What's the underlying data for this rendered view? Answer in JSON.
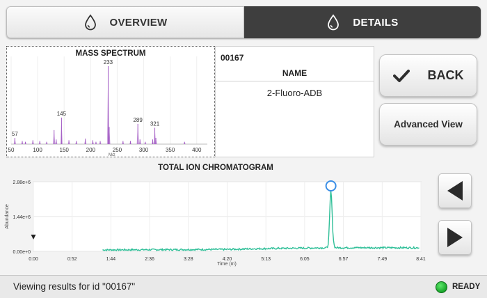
{
  "tabs": [
    {
      "label": "OVERVIEW",
      "icon": "droplet-icon",
      "active": false
    },
    {
      "label": "DETAILS",
      "icon": "droplet-icon",
      "active": true
    }
  ],
  "spectrum": {
    "title": "MASS SPECTRUM",
    "xlabel": "M/z",
    "x_ticks": [
      "50",
      "100",
      "150",
      "200",
      "250",
      "300",
      "350",
      "400"
    ]
  },
  "info": {
    "id": "00167",
    "name_label": "NAME",
    "name_value": "2-Fluoro-ADB"
  },
  "buttons": {
    "back": "BACK",
    "advanced": "Advanced View"
  },
  "tic": {
    "title": "TOTAL ION CHROMATOGRAM",
    "ylabel": "Abundance",
    "xlabel": "Time (m)",
    "y_ticks": [
      "2.88e+6",
      "1.44e+6",
      "0.00e+0"
    ],
    "x_ticks": [
      "0:00",
      "0:52",
      "1:44",
      "2:36",
      "3:28",
      "4:20",
      "5:13",
      "6:05",
      "6:57",
      "7:49",
      "8:41"
    ]
  },
  "status": {
    "text": "Viewing results for id \"00167\"",
    "ready": "READY",
    "ready_color": "#22b43a"
  },
  "colors": {
    "spectrum_peaks": "#a35bc4",
    "tic_line": "#2fbf98",
    "marker": "#3a8ee6",
    "tab_active_bg": "#3e3e3e"
  },
  "chart_data": [
    {
      "type": "bar",
      "title": "MASS SPECTRUM",
      "xlabel": "M/z",
      "ylabel": "",
      "xlim": [
        50,
        420
      ],
      "ylim": [
        0,
        100
      ],
      "peaks": [
        {
          "mz": 57,
          "intensity": 8,
          "label": "57"
        },
        {
          "mz": 71,
          "intensity": 4
        },
        {
          "mz": 77,
          "intensity": 3
        },
        {
          "mz": 91,
          "intensity": 5
        },
        {
          "mz": 104,
          "intensity": 4
        },
        {
          "mz": 117,
          "intensity": 3
        },
        {
          "mz": 131,
          "intensity": 18
        },
        {
          "mz": 135,
          "intensity": 6
        },
        {
          "mz": 145,
          "intensity": 34,
          "label": "145"
        },
        {
          "mz": 159,
          "intensity": 5
        },
        {
          "mz": 173,
          "intensity": 4
        },
        {
          "mz": 190,
          "intensity": 7
        },
        {
          "mz": 204,
          "intensity": 5
        },
        {
          "mz": 210,
          "intensity": 3
        },
        {
          "mz": 218,
          "intensity": 4
        },
        {
          "mz": 233,
          "intensity": 100,
          "label": "233"
        },
        {
          "mz": 235,
          "intensity": 22
        },
        {
          "mz": 261,
          "intensity": 4
        },
        {
          "mz": 275,
          "intensity": 4
        },
        {
          "mz": 289,
          "intensity": 26,
          "label": "289"
        },
        {
          "mz": 293,
          "intensity": 6
        },
        {
          "mz": 303,
          "intensity": 3
        },
        {
          "mz": 317,
          "intensity": 6
        },
        {
          "mz": 321,
          "intensity": 21,
          "label": "321"
        },
        {
          "mz": 323,
          "intensity": 8
        },
        {
          "mz": 377,
          "intensity": 3
        }
      ]
    },
    {
      "type": "line",
      "title": "TOTAL ION CHROMATOGRAM",
      "xlabel": "Time (m)",
      "ylabel": "Abundance",
      "xlim_seconds": [
        0,
        521
      ],
      "ylim": [
        0,
        2880000
      ],
      "trace_start_seconds": 93,
      "baseline_abundance": [
        {
          "t": 93,
          "y": 60000
        },
        {
          "t": 260,
          "y": 80000
        },
        {
          "t": 300,
          "y": 110000
        },
        {
          "t": 350,
          "y": 130000
        },
        {
          "t": 400,
          "y": 150000
        },
        {
          "t": 520,
          "y": 150000
        }
      ],
      "peak": {
        "t": 400,
        "y": 2500000
      },
      "marker_t": 400,
      "cursor_t": 0
    }
  ]
}
